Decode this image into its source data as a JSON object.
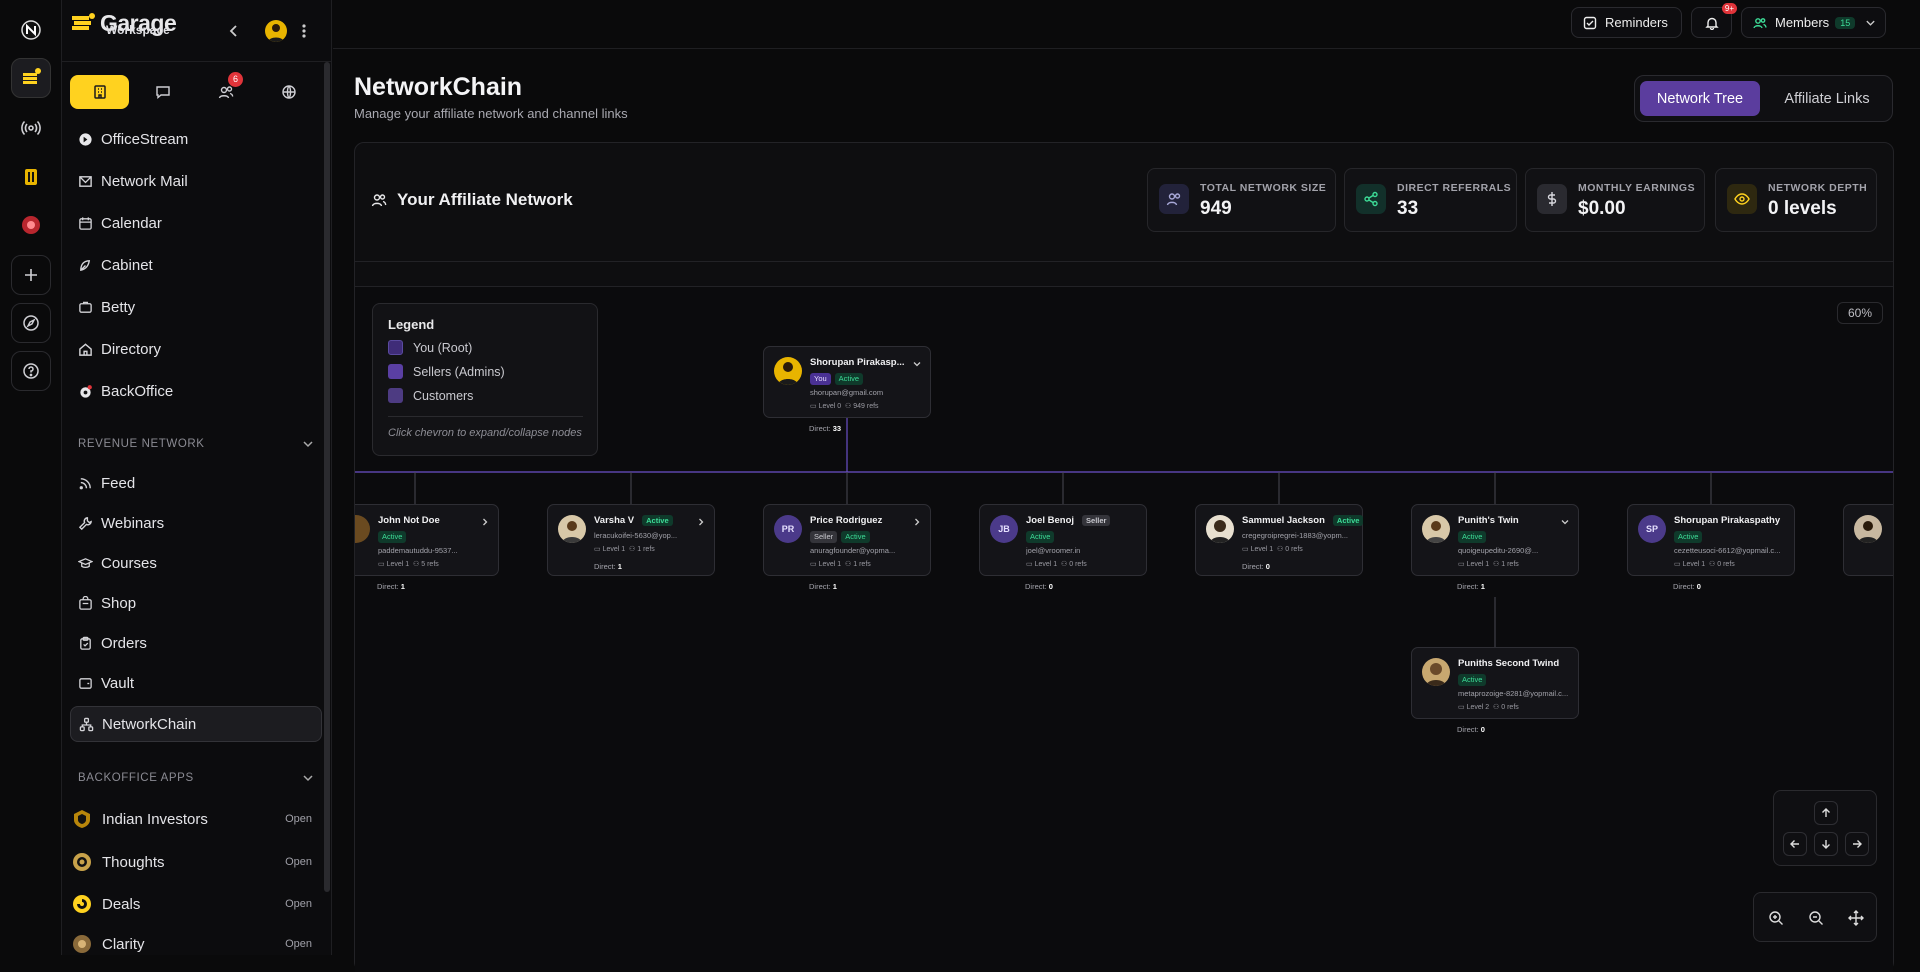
{
  "brand": {
    "name": "Garage",
    "subtitle": "Workspace"
  },
  "sidebar": {
    "tabs_badge": "6",
    "nav": [
      {
        "label": "OfficeStream",
        "icon": "officestream-icon"
      },
      {
        "label": "Network Mail",
        "icon": "mail-icon"
      },
      {
        "label": "Calendar",
        "icon": "calendar-icon"
      },
      {
        "label": "Cabinet",
        "icon": "cabinet-icon"
      },
      {
        "label": "Betty",
        "icon": "betty-icon"
      },
      {
        "label": "Directory",
        "icon": "home-icon"
      },
      {
        "label": "BackOffice",
        "icon": "backoffice-icon"
      }
    ],
    "revenue_section": "REVENUE NETWORK",
    "revenue": [
      {
        "label": "Feed",
        "icon": "rss-icon"
      },
      {
        "label": "Webinars",
        "icon": "wrench-icon"
      },
      {
        "label": "Courses",
        "icon": "graduation-cap-icon"
      },
      {
        "label": "Shop",
        "icon": "shop-icon"
      },
      {
        "label": "Orders",
        "icon": "clipboard-icon"
      },
      {
        "label": "Vault",
        "icon": "vault-icon"
      },
      {
        "label": "NetworkChain",
        "icon": "network-icon"
      }
    ],
    "apps_section": "BACKOFFICE APPS",
    "apps": [
      {
        "label": "Indian Investors",
        "action": "Open"
      },
      {
        "label": "Thoughts",
        "action": "Open"
      },
      {
        "label": "Deals",
        "action": "Open"
      },
      {
        "label": "Clarity",
        "action": "Open"
      }
    ]
  },
  "topbar": {
    "reminders": "Reminders",
    "notif_badge": "9+",
    "members": "Members",
    "members_count": "15"
  },
  "page": {
    "title": "NetworkChain",
    "subtitle": "Manage your affiliate network and channel links",
    "toggle": {
      "active": "Network Tree",
      "inactive": "Affiliate Links"
    }
  },
  "network": {
    "heading": "Your Affiliate Network",
    "stats": [
      {
        "label": "TOTAL NETWORK SIZE",
        "value": "949"
      },
      {
        "label": "DIRECT REFERRALS",
        "value": "33"
      },
      {
        "label": "MONTHLY EARNINGS",
        "value": "$0.00"
      },
      {
        "label": "NETWORK DEPTH",
        "value": "0 levels"
      }
    ]
  },
  "legend": {
    "title": "Legend",
    "items": [
      {
        "label": "You (Root)",
        "color": "#3f2c78"
      },
      {
        "label": "Sellers (Admins)",
        "color": "#5a3fa3"
      },
      {
        "label": "Customers",
        "color": "#4d3b82"
      }
    ],
    "note": "Click chevron to expand/collapse nodes"
  },
  "zoom": "60%",
  "tree": {
    "root": {
      "name": "Shorupan Pirakasp...",
      "tags": [
        "You",
        "Active"
      ],
      "email": "shorupan@gmail.com",
      "level": "Level 0",
      "refs": "949 refs",
      "direct_label": "Direct:",
      "direct": "33"
    },
    "children": [
      {
        "name": "John Not Doe",
        "tags": [
          "Active"
        ],
        "email": "paddemautuddu-9537...",
        "level": "Level 1",
        "refs": "5 refs",
        "direct": "1"
      },
      {
        "name": "Varsha V",
        "tags": [
          "Active"
        ],
        "email": "leracukoifei-5630@yop...",
        "level": "Level 1",
        "refs": "1 refs",
        "direct": "1"
      },
      {
        "name": "Price Rodriguez",
        "initials": "PR",
        "tags": [
          "Seller",
          "Active"
        ],
        "email": "anuragfounder@yopma...",
        "level": "Level 1",
        "refs": "1 refs",
        "direct": "1"
      },
      {
        "name": "Joel Benoj",
        "initials": "JB",
        "tags": [
          "Seller",
          "Active"
        ],
        "email": "joel@vroomer.in",
        "level": "Level 1",
        "refs": "0 refs",
        "direct": "0"
      },
      {
        "name": "Sammuel Jackson",
        "tags": [
          "Active"
        ],
        "email": "cregegroipregrei-1883@yopm...",
        "level": "Level 1",
        "refs": "0 refs",
        "direct": "0"
      },
      {
        "name": "Punith's Twin",
        "tags": [
          "Active"
        ],
        "email": "quoigeupeditu-2690@...",
        "level": "Level 1",
        "refs": "1 refs",
        "direct": "1"
      },
      {
        "name": "Shorupan Pirakaspathy",
        "initials": "SP",
        "tags": [
          "Active"
        ],
        "email": "cezetteusoci-6612@yopmail.c...",
        "level": "Level 1",
        "refs": "0 refs",
        "direct": "0"
      }
    ],
    "grandchild": {
      "name": "Puniths Second Twind",
      "tags": [
        "Active"
      ],
      "email": "metaprozoige-8281@yopmail.c...",
      "level": "Level 2",
      "refs": "0 refs",
      "direct": "0"
    }
  },
  "colors": {
    "accent": "#ffd21f",
    "purple": "#5b3d9e",
    "active_green": "#3ddc97",
    "badge_red": "#e0343a"
  }
}
